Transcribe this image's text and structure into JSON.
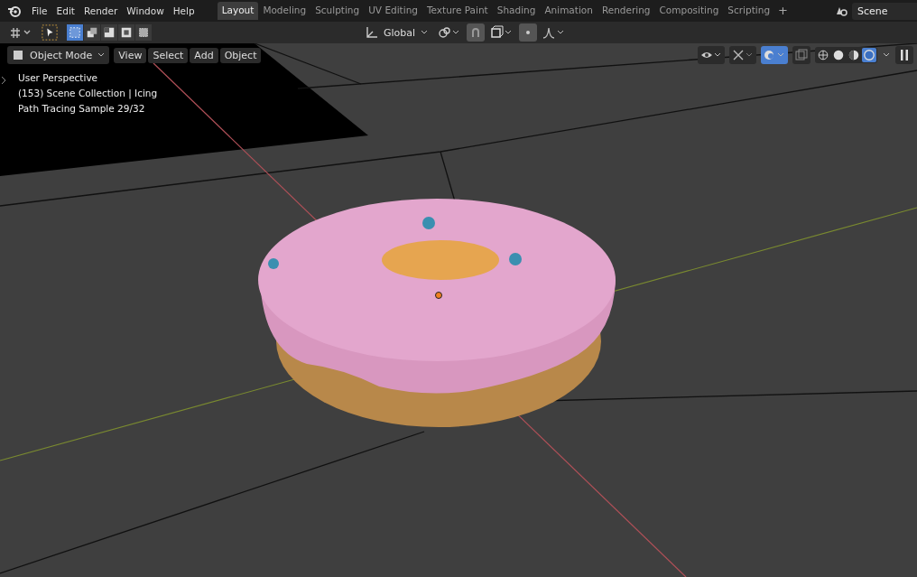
{
  "menu": [
    "File",
    "Edit",
    "Render",
    "Window",
    "Help"
  ],
  "workspaces": [
    {
      "label": "Layout",
      "selected": true
    },
    {
      "label": "Modeling",
      "selected": false
    },
    {
      "label": "Sculpting",
      "selected": false
    },
    {
      "label": "UV Editing",
      "selected": false
    },
    {
      "label": "Texture Paint",
      "selected": false
    },
    {
      "label": "Shading",
      "selected": false
    },
    {
      "label": "Animation",
      "selected": false
    },
    {
      "label": "Rendering",
      "selected": false
    },
    {
      "label": "Compositing",
      "selected": false
    },
    {
      "label": "Scripting",
      "selected": false
    }
  ],
  "add_workspace": "+",
  "scene": {
    "value": "Scene"
  },
  "toolbar": {
    "select_modes": [
      {
        "selected": true
      },
      {
        "selected": false
      },
      {
        "selected": false
      },
      {
        "selected": false
      },
      {
        "selected": false
      }
    ],
    "orientation": "Global"
  },
  "viewport": {
    "mode": "Object Mode",
    "menus": [
      "View",
      "Select",
      "Add",
      "Object"
    ],
    "info": [
      "User Perspective",
      "(153) Scene Collection | Icing",
      "Path Tracing Sample 29/32"
    ],
    "overlays_on": true,
    "shading_modes": [
      {
        "selected": false
      },
      {
        "selected": false
      },
      {
        "selected": false
      },
      {
        "selected": true
      }
    ]
  }
}
